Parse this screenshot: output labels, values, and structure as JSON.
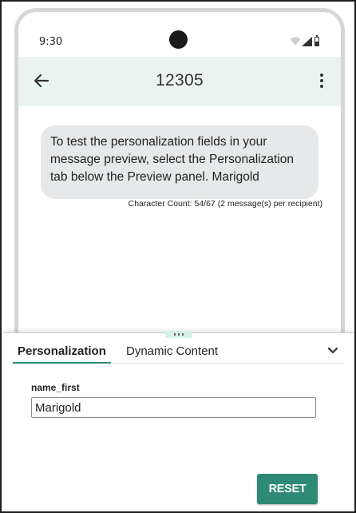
{
  "colors": {
    "accent": "#2e8a74",
    "app_bar_bg": "#e9f4f0",
    "bubble_bg": "#e6e8e9"
  },
  "status_bar": {
    "time": "9:30",
    "icons": [
      "wifi-icon",
      "signal-icon",
      "battery-icon"
    ]
  },
  "app_bar": {
    "back_icon": "arrow-left-icon",
    "title": "12305",
    "more_icon": "more-vertical-icon"
  },
  "message": {
    "text": "To test the personalization fields in your message preview, select the Personalization tab below the Preview panel. Marigold",
    "character_count": "Character Count: 54/67 (2 message(s) per recipient)"
  },
  "panel": {
    "tabs": [
      {
        "label": "Personalization",
        "active": true
      },
      {
        "label": "Dynamic Content",
        "active": false
      }
    ],
    "collapse_icon": "chevron-down-icon",
    "field": {
      "label": "name_first",
      "value": "Marigold"
    },
    "reset_label": "RESET"
  }
}
